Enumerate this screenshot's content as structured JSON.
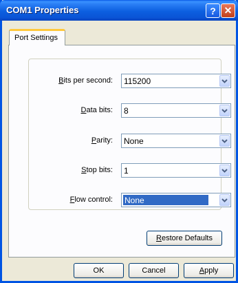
{
  "window": {
    "title": "COM1 Properties"
  },
  "titlebar": {
    "help_label": "?",
    "close_label": "✕"
  },
  "tabs": [
    {
      "label": "Port Settings"
    }
  ],
  "settings": [
    {
      "label_mnemonic": "B",
      "label_rest": "its per second:",
      "value": "115200"
    },
    {
      "label_mnemonic": "D",
      "label_rest": "ata bits:",
      "value": "8"
    },
    {
      "label_pre": "",
      "label_mnemonic": "P",
      "label_rest": "arity:",
      "value": "None"
    },
    {
      "label_mnemonic": "S",
      "label_rest": "top bits:",
      "value": "1"
    },
    {
      "label_mnemonic": "F",
      "label_rest": "low control:",
      "value": "None"
    }
  ],
  "buttons": {
    "restore_mnemonic": "R",
    "restore_rest": "estore Defaults",
    "ok": "OK",
    "cancel": "Cancel",
    "apply_mnemonic": "A",
    "apply_rest": "pply"
  },
  "icons": {
    "combo_arrow": "chevron-down-icon"
  },
  "colors": {
    "titlebar": "#0a54d6",
    "tab_highlight": "#ffc83c",
    "selection": "#316ac5",
    "dialog_bg": "#ece9d8"
  }
}
